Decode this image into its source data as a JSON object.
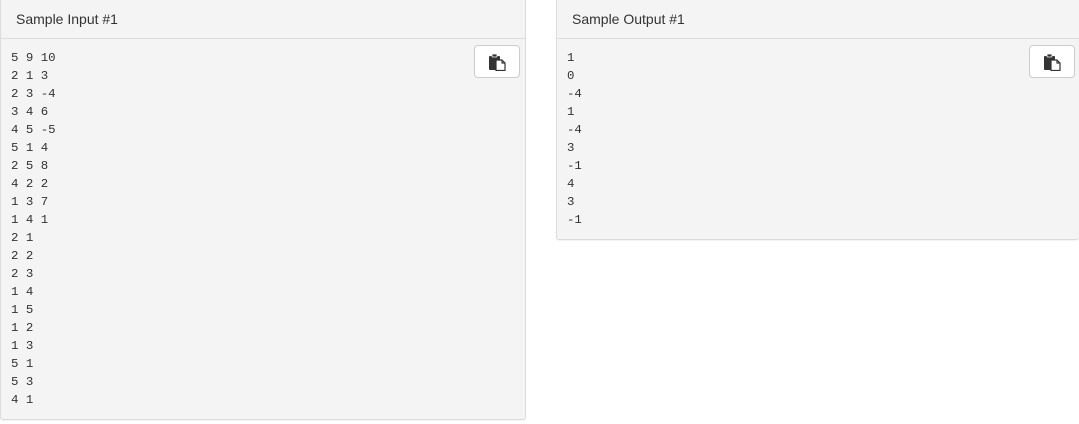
{
  "samples": [
    {
      "title": "Sample Input #1",
      "copy_icon": "clipboard-copy-icon",
      "lines": [
        "5 9 10",
        "2 1 3",
        "2 3 -4",
        "3 4 6",
        "4 5 -5",
        "5 1 4",
        "2 5 8",
        "4 2 2",
        "1 3 7",
        "1 4 1",
        "2 1",
        "2 2",
        "2 3",
        "1 4",
        "1 5",
        "1 2",
        "1 3",
        "5 1",
        "5 3",
        "4 1"
      ]
    },
    {
      "title": "Sample Output #1",
      "copy_icon": "clipboard-copy-icon",
      "lines": [
        "1",
        "0",
        "-4",
        "1",
        "-4",
        "3",
        "-1",
        "4",
        "3",
        "-1"
      ]
    }
  ]
}
